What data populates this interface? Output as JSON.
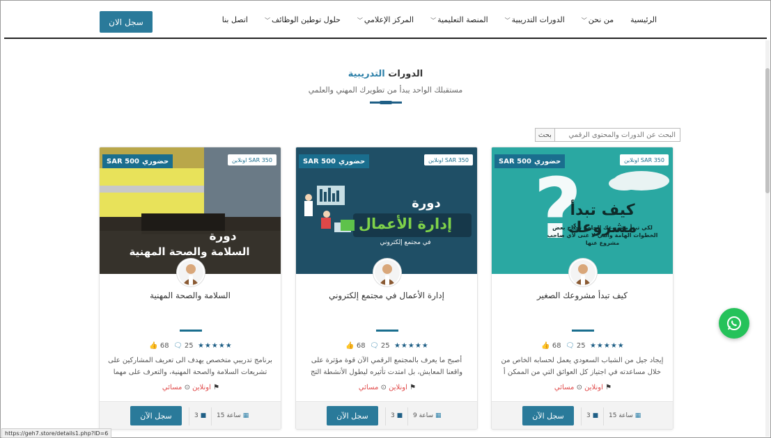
{
  "header": {
    "register_label": "سجل الان",
    "nav": [
      {
        "label": "الرئيسية",
        "dropdown": false
      },
      {
        "label": "من نحن",
        "dropdown": true
      },
      {
        "label": "الدورات التدريبية",
        "dropdown": true
      },
      {
        "label": "المنصة التعليمية",
        "dropdown": true
      },
      {
        "label": "المركز الإعلامي",
        "dropdown": true
      },
      {
        "label": "حلول توطين الوظائف",
        "dropdown": true
      },
      {
        "label": "اتصل بنا",
        "dropdown": false
      }
    ]
  },
  "section": {
    "title_main": "الدورات ",
    "title_accent": "التدريبية",
    "subtitle": "مستقبلك الواحد يبدأ من تطويرك المهني والعلمي"
  },
  "search": {
    "placeholder": "البحث عن الدورات والمحتوى الرقمي",
    "button_label": "بحث"
  },
  "cards": [
    {
      "image_text_top": "كيف تبدأ مشروعك",
      "image_text_sub": "لكي تبدأ مشروعك الخاص تحتاج بعض الخطوات الهامة والتي لا غنى لأي صاحب مشروع عنها",
      "price_label": "حضوري",
      "price": "SAR 500",
      "online_badge": "اونلاين SAR 350",
      "title": "كيف تبدأ مشروعك الصغير",
      "likes": "68",
      "comments": "25",
      "stars": "★★★★★",
      "description": "إيجاد جيل من الشباب السعودي يعمل لحسابه الخاص من خلال مساعدته في اجتياز كل العوائق التي من الممكن أ",
      "mode_online": "اونلاين",
      "mode_evening": "مسائي",
      "hours": "15 ساعة",
      "lessons": "3",
      "register_label": "سجل الآن",
      "theme": "#2aa8a2"
    },
    {
      "image_text_top": "دورة",
      "image_text_main": "إدارة الأعمال",
      "image_text_sub": "في مجتمع إلكتروني",
      "price_label": "حضوري",
      "price": "SAR 500",
      "online_badge": "اونلاين SAR 350",
      "title": "إدارة الأعمال في مجتمع إلكتروني",
      "likes": "68",
      "comments": "25",
      "stars": "★★★★★",
      "description": "أصبح ما يعرف بالمجتمع الرقمي الآن قوة مؤثرة على واقعنا المعايش، بل امتدت تأثيره ليطول الأنشطة التج",
      "mode_online": "اونلاين",
      "mode_evening": "مسائي",
      "hours": "9 ساعة",
      "lessons": "3",
      "register_label": "سجل الآن",
      "theme": "#1f4f66"
    },
    {
      "image_text_top": "دورة",
      "image_text_main": "السلامة والصحة المهنية",
      "price_label": "حضوري",
      "price": "SAR 500",
      "online_badge": "اونلاين SAR 350",
      "title": "السلامة والصحة المهنية",
      "likes": "68",
      "comments": "25",
      "stars": "★★★★★",
      "description": "برنامج تدريبي متخصص يهدف الى تعريف المشاركين على تشريعات السلامة والصحة المهنية، والتعرف على مهما",
      "mode_online": "اونلاين",
      "mode_evening": "مسائي",
      "hours": "15 ساعة",
      "lessons": "3",
      "register_label": "سجل الآن",
      "theme": "#c9b04a"
    }
  ],
  "status_url": "https://geh7.store/details1.php?ID=6",
  "colors": {
    "brand": "#2a7a9a",
    "accent": "#2b7fa8",
    "whatsapp": "#25c25a",
    "alert": "#e04848"
  }
}
